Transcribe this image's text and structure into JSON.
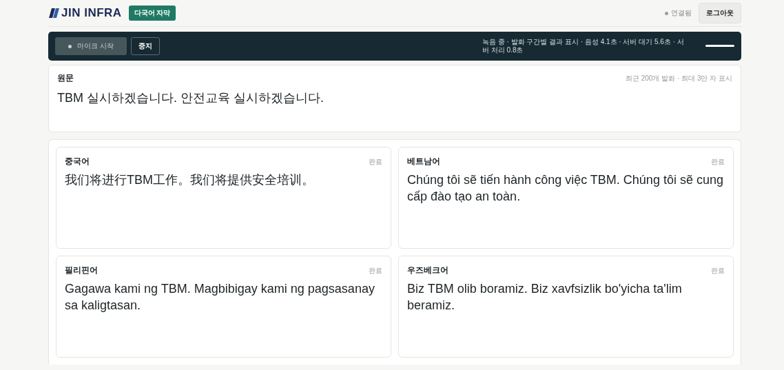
{
  "header": {
    "logo": "JIN INFRA",
    "mode_badge": "다국어 자막",
    "connection": {
      "label": "연결됨",
      "connected": true
    },
    "logout": "로그아웃"
  },
  "control_bar": {
    "mic_button": "마이크 시작",
    "stop_button": "중지",
    "status": "녹음 중 · 발화 구간별 결과 표시 · 음성 4.1초 · 서버 대기 5.6초 · 서버 처리 0.8초"
  },
  "source": {
    "title": "원문",
    "note": "최근 200개 발화 · 최대 3만 자 표시",
    "text": "TBM 실시하겠습니다. 안전교육 실시하겠습니다."
  },
  "translations": [
    {
      "language": "중국어",
      "status": "완료",
      "text": "我们将进行TBM工作。我们将提供安全培训。"
    },
    {
      "language": "베트남어",
      "status": "완료",
      "text": "Chúng tôi sẽ tiến hành công việc TBM. Chúng tôi sẽ cung cấp đào tạo an toàn."
    },
    {
      "language": "필리핀어",
      "status": "완료",
      "text": "Gagawa kami ng TBM. Magbibigay kami ng pagsasanay sa kaligtasan."
    },
    {
      "language": "우즈베크어",
      "status": "완료",
      "text": "Biz TBM olib boramiz. Biz xavfsizlik bo'yicha ta'lim beramiz."
    }
  ]
}
